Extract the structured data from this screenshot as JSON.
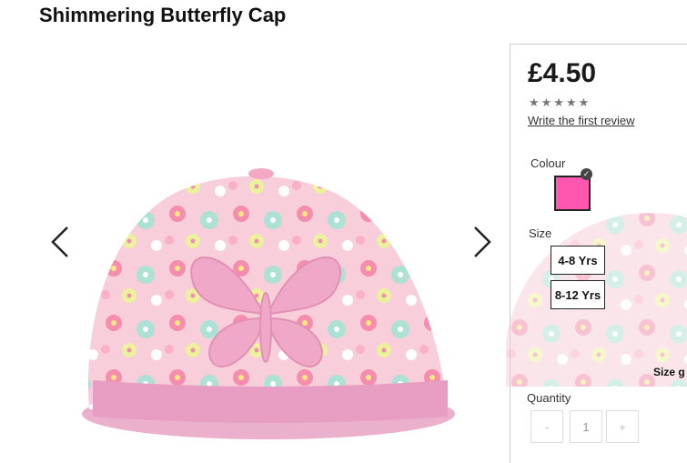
{
  "product": {
    "title": "Shimmering Butterfly Cap"
  },
  "gallery": {
    "prev_icon": "chevron-left-icon",
    "next_icon": "chevron-right-icon"
  },
  "purchase": {
    "price": "£4.50",
    "rating": {
      "stars": "★★★★★",
      "filled": 0,
      "out_of": 5
    },
    "review_link": "Write the first review",
    "colour_label": "Colour",
    "colour": {
      "hex": "#ff57b0",
      "selected": true
    },
    "size_label": "Size",
    "sizes": [
      {
        "label": "4-8 Yrs"
      },
      {
        "label": "8-12 Yrs"
      }
    ],
    "size_guide": "Size g",
    "quantity_label": "Quantity",
    "quantity": {
      "minus": "-",
      "value": "1",
      "plus": "+"
    }
  }
}
